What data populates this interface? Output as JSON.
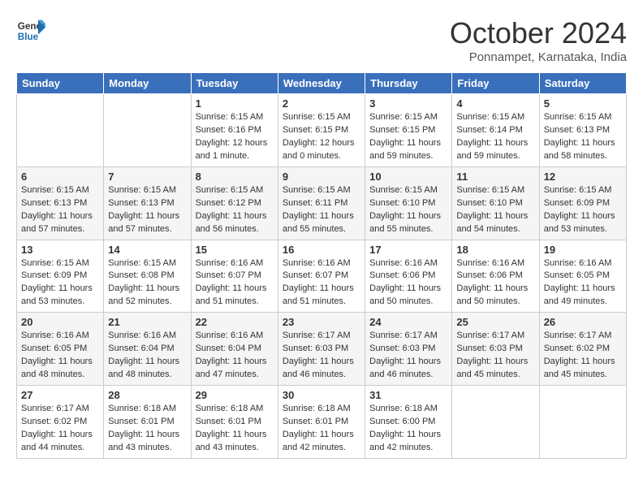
{
  "header": {
    "logo_general": "General",
    "logo_blue": "Blue",
    "month": "October 2024",
    "location": "Ponnampet, Karnataka, India"
  },
  "days_of_week": [
    "Sunday",
    "Monday",
    "Tuesday",
    "Wednesday",
    "Thursday",
    "Friday",
    "Saturday"
  ],
  "weeks": [
    [
      {
        "day": "",
        "info": ""
      },
      {
        "day": "",
        "info": ""
      },
      {
        "day": "1",
        "info": "Sunrise: 6:15 AM\nSunset: 6:16 PM\nDaylight: 12 hours\nand 1 minute."
      },
      {
        "day": "2",
        "info": "Sunrise: 6:15 AM\nSunset: 6:15 PM\nDaylight: 12 hours\nand 0 minutes."
      },
      {
        "day": "3",
        "info": "Sunrise: 6:15 AM\nSunset: 6:15 PM\nDaylight: 11 hours\nand 59 minutes."
      },
      {
        "day": "4",
        "info": "Sunrise: 6:15 AM\nSunset: 6:14 PM\nDaylight: 11 hours\nand 59 minutes."
      },
      {
        "day": "5",
        "info": "Sunrise: 6:15 AM\nSunset: 6:13 PM\nDaylight: 11 hours\nand 58 minutes."
      }
    ],
    [
      {
        "day": "6",
        "info": "Sunrise: 6:15 AM\nSunset: 6:13 PM\nDaylight: 11 hours\nand 57 minutes."
      },
      {
        "day": "7",
        "info": "Sunrise: 6:15 AM\nSunset: 6:13 PM\nDaylight: 11 hours\nand 57 minutes."
      },
      {
        "day": "8",
        "info": "Sunrise: 6:15 AM\nSunset: 6:12 PM\nDaylight: 11 hours\nand 56 minutes."
      },
      {
        "day": "9",
        "info": "Sunrise: 6:15 AM\nSunset: 6:11 PM\nDaylight: 11 hours\nand 55 minutes."
      },
      {
        "day": "10",
        "info": "Sunrise: 6:15 AM\nSunset: 6:10 PM\nDaylight: 11 hours\nand 55 minutes."
      },
      {
        "day": "11",
        "info": "Sunrise: 6:15 AM\nSunset: 6:10 PM\nDaylight: 11 hours\nand 54 minutes."
      },
      {
        "day": "12",
        "info": "Sunrise: 6:15 AM\nSunset: 6:09 PM\nDaylight: 11 hours\nand 53 minutes."
      }
    ],
    [
      {
        "day": "13",
        "info": "Sunrise: 6:15 AM\nSunset: 6:09 PM\nDaylight: 11 hours\nand 53 minutes."
      },
      {
        "day": "14",
        "info": "Sunrise: 6:15 AM\nSunset: 6:08 PM\nDaylight: 11 hours\nand 52 minutes."
      },
      {
        "day": "15",
        "info": "Sunrise: 6:16 AM\nSunset: 6:07 PM\nDaylight: 11 hours\nand 51 minutes."
      },
      {
        "day": "16",
        "info": "Sunrise: 6:16 AM\nSunset: 6:07 PM\nDaylight: 11 hours\nand 51 minutes."
      },
      {
        "day": "17",
        "info": "Sunrise: 6:16 AM\nSunset: 6:06 PM\nDaylight: 11 hours\nand 50 minutes."
      },
      {
        "day": "18",
        "info": "Sunrise: 6:16 AM\nSunset: 6:06 PM\nDaylight: 11 hours\nand 50 minutes."
      },
      {
        "day": "19",
        "info": "Sunrise: 6:16 AM\nSunset: 6:05 PM\nDaylight: 11 hours\nand 49 minutes."
      }
    ],
    [
      {
        "day": "20",
        "info": "Sunrise: 6:16 AM\nSunset: 6:05 PM\nDaylight: 11 hours\nand 48 minutes."
      },
      {
        "day": "21",
        "info": "Sunrise: 6:16 AM\nSunset: 6:04 PM\nDaylight: 11 hours\nand 48 minutes."
      },
      {
        "day": "22",
        "info": "Sunrise: 6:16 AM\nSunset: 6:04 PM\nDaylight: 11 hours\nand 47 minutes."
      },
      {
        "day": "23",
        "info": "Sunrise: 6:17 AM\nSunset: 6:03 PM\nDaylight: 11 hours\nand 46 minutes."
      },
      {
        "day": "24",
        "info": "Sunrise: 6:17 AM\nSunset: 6:03 PM\nDaylight: 11 hours\nand 46 minutes."
      },
      {
        "day": "25",
        "info": "Sunrise: 6:17 AM\nSunset: 6:03 PM\nDaylight: 11 hours\nand 45 minutes."
      },
      {
        "day": "26",
        "info": "Sunrise: 6:17 AM\nSunset: 6:02 PM\nDaylight: 11 hours\nand 45 minutes."
      }
    ],
    [
      {
        "day": "27",
        "info": "Sunrise: 6:17 AM\nSunset: 6:02 PM\nDaylight: 11 hours\nand 44 minutes."
      },
      {
        "day": "28",
        "info": "Sunrise: 6:18 AM\nSunset: 6:01 PM\nDaylight: 11 hours\nand 43 minutes."
      },
      {
        "day": "29",
        "info": "Sunrise: 6:18 AM\nSunset: 6:01 PM\nDaylight: 11 hours\nand 43 minutes."
      },
      {
        "day": "30",
        "info": "Sunrise: 6:18 AM\nSunset: 6:01 PM\nDaylight: 11 hours\nand 42 minutes."
      },
      {
        "day": "31",
        "info": "Sunrise: 6:18 AM\nSunset: 6:00 PM\nDaylight: 11 hours\nand 42 minutes."
      },
      {
        "day": "",
        "info": ""
      },
      {
        "day": "",
        "info": ""
      }
    ]
  ]
}
